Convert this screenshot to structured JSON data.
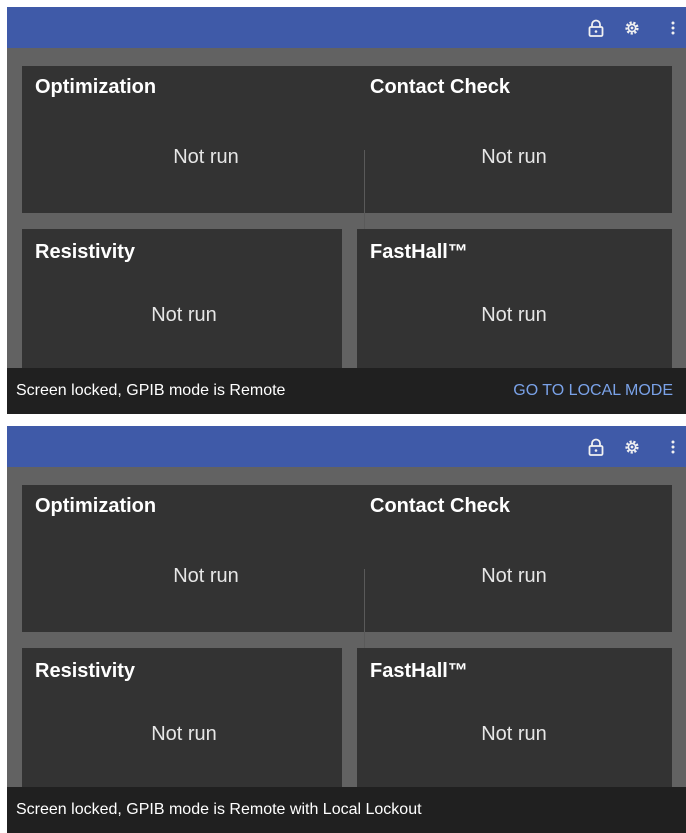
{
  "screens": [
    {
      "toolbar_icons": [
        "lock-icon",
        "gear-icon",
        "more-vert-icon"
      ],
      "cards": [
        {
          "title": "Optimization",
          "value": "Not run"
        },
        {
          "title": "Contact Check",
          "value": "Not run"
        },
        {
          "title": "Resistivity",
          "value": "Not run"
        },
        {
          "title": "FastHall™",
          "value": "Not run"
        }
      ],
      "status": {
        "text": "Screen locked, GPIB mode is Remote",
        "action": "GO TO LOCAL MODE"
      }
    },
    {
      "toolbar_icons": [
        "lock-icon",
        "gear-icon",
        "more-vert-icon"
      ],
      "cards": [
        {
          "title": "Optimization",
          "value": "Not run"
        },
        {
          "title": "Contact Check",
          "value": "Not run"
        },
        {
          "title": "Resistivity",
          "value": "Not run"
        },
        {
          "title": "FastHall™",
          "value": "Not run"
        }
      ],
      "status": {
        "text": "Screen locked, GPIB mode is Remote with Local Lockout"
      }
    }
  ],
  "colors": {
    "appbar": "#3f5aa8",
    "background": "#626262",
    "card": "#333333",
    "statusbar": "#202020",
    "action_link": "#7aa2e8"
  }
}
